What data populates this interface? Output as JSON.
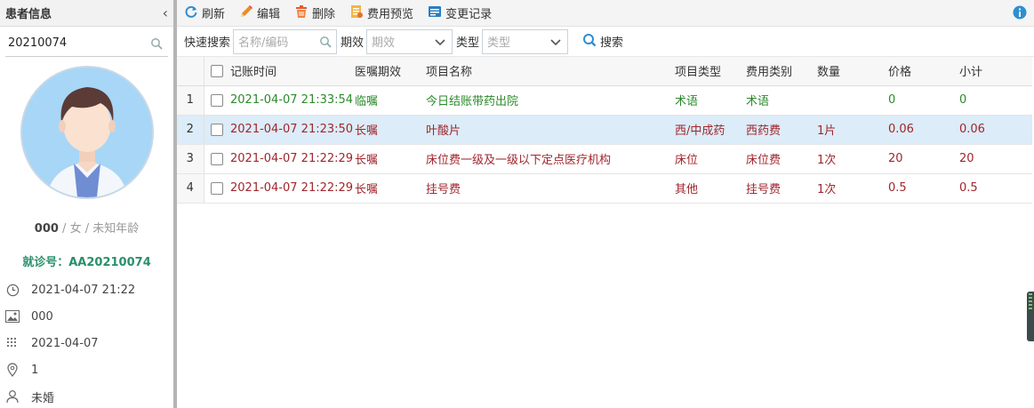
{
  "sidebar": {
    "title": "患者信息",
    "search_value": "20210074",
    "patient_name": "000",
    "patient_sex_age": " / 女 / 未知年龄",
    "visit_label": "就诊号：AA20210074",
    "info": [
      {
        "icon": "clock-icon",
        "text": "2021-04-07 21:22"
      },
      {
        "icon": "image-icon",
        "text": "000"
      },
      {
        "icon": "calendar-icon",
        "text": "2021-04-07"
      },
      {
        "icon": "location-icon",
        "text": "1"
      },
      {
        "icon": "person-icon",
        "text": "未婚"
      }
    ]
  },
  "toolbar": {
    "refresh": "刷新",
    "edit": "编辑",
    "delete": "删除",
    "fee_preview": "费用预览",
    "change_log": "变更记录"
  },
  "filter": {
    "quick_search_label": "快速搜索",
    "quick_search_placeholder": "名称/编码",
    "period_label": "期效",
    "period_placeholder": "期效",
    "type_label": "类型",
    "type_placeholder": "类型",
    "search_button": "搜索"
  },
  "table": {
    "columns": [
      "记账时间",
      "医嘱期效",
      "项目名称",
      "项目类型",
      "费用类别",
      "数量",
      "价格",
      "小计"
    ],
    "rows": [
      {
        "no": "1",
        "time": "2021-04-07 21:33:54",
        "period": "临嘱",
        "name": "今日结账带药出院",
        "type": "术语",
        "fee": "术语",
        "qty": "",
        "price": "0",
        "subtotal": "0",
        "color": "green"
      },
      {
        "no": "2",
        "time": "2021-04-07 21:23:50",
        "period": "长嘱",
        "name": "叶酸片",
        "type": "西/中成药",
        "fee": "西药费",
        "qty": "1片",
        "price": "0.06",
        "subtotal": "0.06",
        "color": "red"
      },
      {
        "no": "3",
        "time": "2021-04-07 21:22:29",
        "period": "长嘱",
        "name": "床位费一级及一级以下定点医疗机构",
        "type": "床位",
        "fee": "床位费",
        "qty": "1次",
        "price": "20",
        "subtotal": "20",
        "color": "red"
      },
      {
        "no": "4",
        "time": "2021-04-07 21:22:29",
        "period": "长嘱",
        "name": "挂号费",
        "type": "其他",
        "fee": "挂号费",
        "qty": "1次",
        "price": "0.5",
        "subtotal": "0.5",
        "color": "red"
      }
    ],
    "selected_row": 1
  },
  "colors": {
    "green_text": "#2b8a2b",
    "red_text": "#a0262c",
    "selected_row": "#dcecf8",
    "visit_green": "#2a8f6a"
  }
}
